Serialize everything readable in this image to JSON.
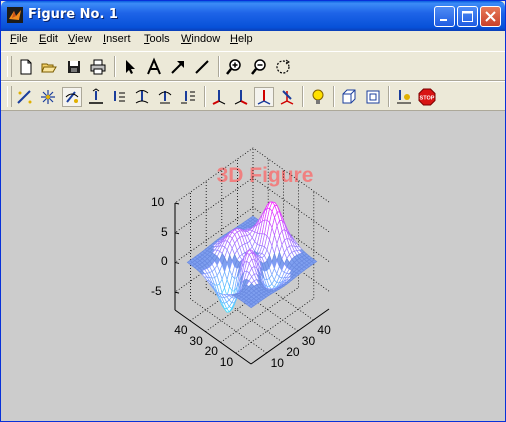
{
  "window": {
    "title": "Figure No. 1",
    "controls": {
      "minimize": "minimize",
      "maximize": "maximize",
      "close": "close"
    }
  },
  "menu": {
    "items": [
      {
        "mnemonic": "F",
        "rest": "ile"
      },
      {
        "mnemonic": "E",
        "rest": "dit"
      },
      {
        "mnemonic": "V",
        "rest": "iew"
      },
      {
        "mnemonic": "I",
        "rest": "nsert"
      },
      {
        "mnemonic": "T",
        "rest": "ools"
      },
      {
        "mnemonic": "W",
        "rest": "indow"
      },
      {
        "mnemonic": "H",
        "rest": "elp"
      }
    ]
  },
  "toolbar1": {
    "icons": [
      "new-file-icon",
      "open-folder-icon",
      "save-icon",
      "print-icon",
      "arrow-pointer-icon",
      "text-icon",
      "arrow-line-icon",
      "line-icon",
      "zoom-in-icon",
      "zoom-out-icon",
      "rotate-icon"
    ]
  },
  "toolbar2": {
    "icons": [
      "edit-plot-icon",
      "data-points-icon",
      "camera-orbit-icon",
      "camera-pan-icon",
      "camera-dolly-icon",
      "camera-roll-icon",
      "camera-walk-icon",
      "camera-zoom-icon",
      "principal-axis-x-icon",
      "principal-axis-y-icon",
      "principal-axis-z-icon",
      "principal-axis-none-icon",
      "light-icon",
      "perspective-icon",
      "orthographic-icon",
      "reset-camera-icon",
      "stop-icon"
    ],
    "stop_label": "STOP"
  },
  "figure": {
    "title": "3D Figure",
    "title_color": "#f08080",
    "background": "#cccccc"
  },
  "chart_data": {
    "type": "surface",
    "title": "3D Figure",
    "z_ticks": [
      "10",
      "5",
      "0",
      "-5"
    ],
    "y_ticks": [
      "40",
      "30",
      "20",
      "10"
    ],
    "x_ticks": [
      "40",
      "30",
      "20",
      "10"
    ],
    "zlim": [
      -8,
      10
    ],
    "xlim": [
      0,
      50
    ],
    "ylim": [
      0,
      50
    ],
    "grid": true,
    "colormap": "cool"
  }
}
